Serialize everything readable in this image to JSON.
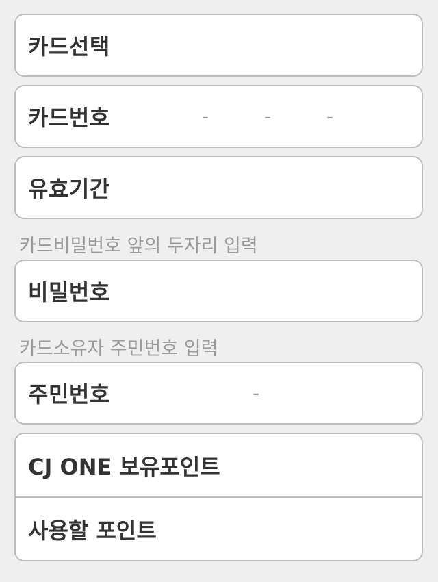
{
  "fields": {
    "card_select": {
      "label": "카드선택"
    },
    "card_number": {
      "label": "카드번호",
      "separator": "-"
    },
    "expiry": {
      "label": "유효기간"
    },
    "password_hint": "카드비밀번호 앞의 두자리 입력",
    "password": {
      "label": "비밀번호"
    },
    "resident_hint": "카드소유자 주민번호 입력",
    "resident_number": {
      "label": "주민번호",
      "separator": "-"
    }
  },
  "points": {
    "owned_label": "CJ ONE 보유포인트",
    "use_label": "사용할 포인트"
  },
  "colors": {
    "background": "#efefef",
    "border": "#bdbdbd",
    "label_text": "#333333",
    "hint_text": "#9a9a9a"
  }
}
